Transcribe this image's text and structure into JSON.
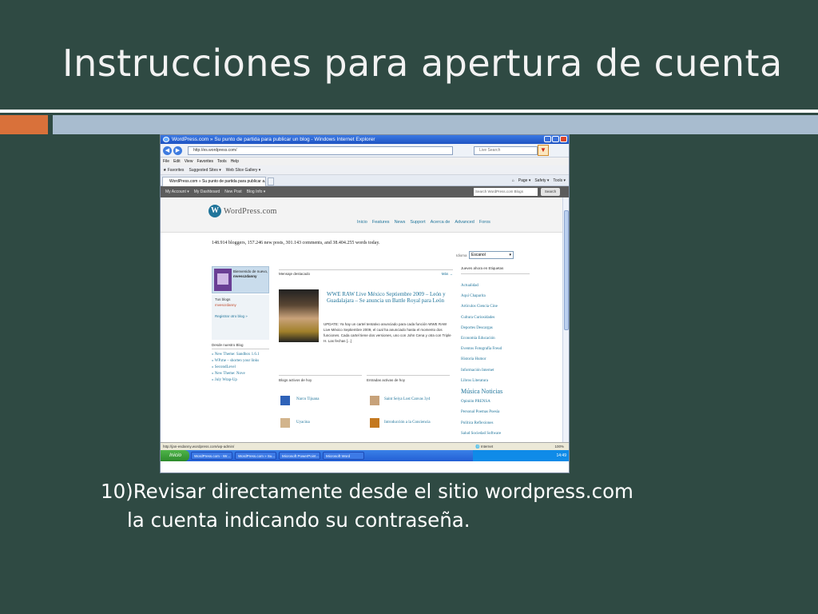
{
  "slide": {
    "title": "Instrucciones para apertura de cuenta",
    "step_line1": "10)Revisar directamente desde el sitio wordpress.com",
    "step_line2": "la cuenta indicando su contraseña."
  },
  "colors": {
    "background": "#2f4a43",
    "band_orange": "#d9713a",
    "band_blue": "#a8bccf"
  },
  "browser": {
    "window_title": "WordPress.com » Su punto de partida para publicar un blog - Windows Internet Explorer",
    "address": "http://es.wordpress.com/",
    "search_placeholder": "Live Search",
    "menu": [
      "File",
      "Edit",
      "View",
      "Favorites",
      "Tools",
      "Help"
    ],
    "favorites": [
      "Favorites",
      "Suggested Sites ▾",
      "Web Slice Gallery ▾"
    ],
    "tab": "WordPress.com » Su punto de partida para publicar a...",
    "command_bar": [
      "Page ▾",
      "Safety ▾",
      "Tools ▾"
    ],
    "status_url": "http://jan-esdanny.wordpress.com/wp-admin/",
    "status_zone": "Internet",
    "status_zoom": "100%"
  },
  "wordpress": {
    "topbar": [
      "My Account ▾",
      "My Dashboard",
      "New Post",
      "Blog Info ▾"
    ],
    "search_placeholder": "Search WordPress.com Blogs",
    "search_button": "Search",
    "logo": "WordPress.com",
    "nav": [
      "Inicio",
      "Features",
      "News",
      "Support",
      "Acerca de",
      "Advanced",
      "Foros"
    ],
    "stats": "148.914 bloggers, 157.246 new posts, 301.143 comments, and 38.404.255 words today.",
    "idioma_label": "Idioma",
    "idioma_value": "Escanol",
    "user_greeting": "Bienvenido de nuevo,",
    "user_name": "mvesczdanny",
    "sidebar_tus_blogs": "Tus blogs",
    "sidebar_blog": "mvescrdanny",
    "sidebar_register": "Registrar otro blog »",
    "desde_title": "Desde nuestro Blog",
    "desde_items": [
      "New Theme: Sandbox 1.6.1",
      "WP.me – shorten your links",
      "SecondLevel",
      "New Theme: Nove",
      "July Wrap-Up"
    ],
    "featured_label": "Mensaje destacado",
    "featured_title": "WWE RAW Live México Septiembre 2009 – León y Guadalajara – Se anuncia un Battle Royal para León",
    "featured_text": "UPDATE: Ya hay un cartel tentativo anunciado para cada función WWE RAW Live México Septiembre 2009, el cual ha anunciado hasta el momento dos funciones. Cada cartel tiene dos versiones, uno con John Cena y otra con Triple H. Las fechas [...]",
    "blogs_hoy_label": "Blogs activos de hoy",
    "entradas_hoy_label": "Entradas activas de hoy",
    "blogs_hoy": [
      "Narco Tijuana",
      "Uyacina"
    ],
    "entradas_hoy": [
      "Saint Seiya Lost Canvas 3y4",
      "Introducción a la Conciencia"
    ],
    "tags_head": "Jueves ahora en Etiquetas",
    "tags": [
      "Actualidad",
      "Aquí Chaparita",
      "Artículos Ciencia Cine",
      "Cultura Curiosidades",
      "Deportes Descargas",
      "Economía Educación",
      "Eventos Fotografía Freud",
      "Historia Humor",
      "Información Internet",
      "Libros Literatura",
      "Música Noticias",
      "Opinión PRENSA",
      "Personal Poemas Poesía",
      "Política Reflexiones",
      "Salud Sociedad Software"
    ],
    "more_link": "Más →"
  },
  "taskbar": {
    "start": "Inicio",
    "items": [
      "WordPress.com - Wr...",
      "WordPress.com » Su...",
      "Microsoft PowerPoint...",
      "Microsoft Word"
    ],
    "clock": "14:49"
  }
}
